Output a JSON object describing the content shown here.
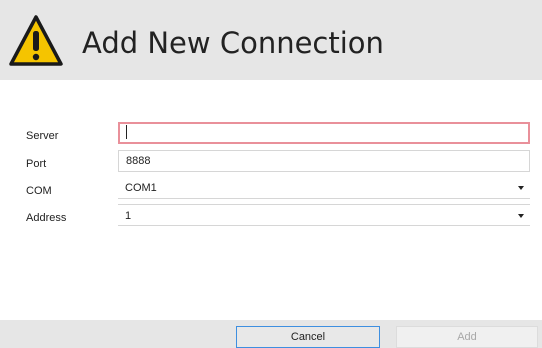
{
  "dialog": {
    "title": "Add New Connection",
    "icon": "warning-triangle-icon",
    "accent_color": "#f5c400"
  },
  "form": {
    "server": {
      "label": "Server",
      "value": "",
      "state": "invalid",
      "border_color": "#e9909a"
    },
    "port": {
      "label": "Port",
      "value": "8888"
    },
    "com": {
      "label": "COM",
      "selected": "COM1"
    },
    "address": {
      "label": "Address",
      "selected": "1"
    }
  },
  "footer": {
    "cancel_label": "Cancel",
    "add_label": "Add",
    "focus_color": "#3e8fe0"
  }
}
